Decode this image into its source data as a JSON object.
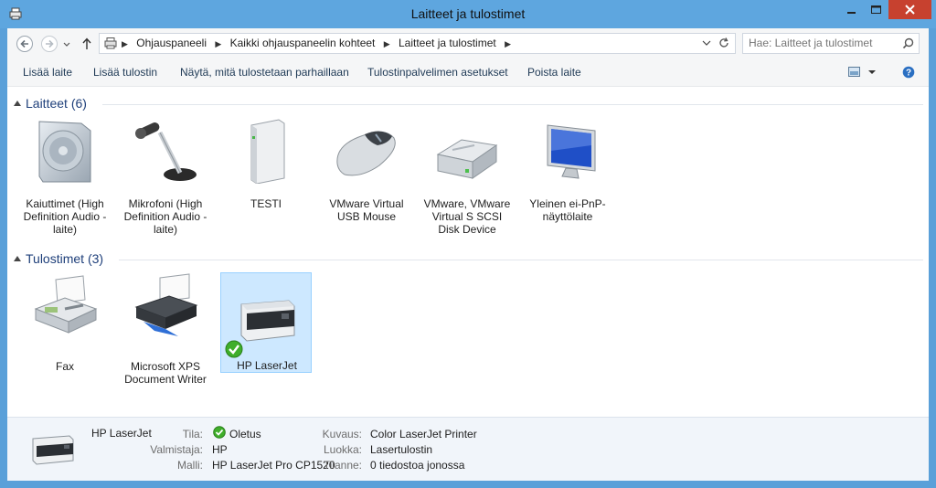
{
  "window": {
    "title": "Laitteet ja tulostimet"
  },
  "nav": {
    "breadcrumbs": [
      "Ohjauspaneeli",
      "Kaikki ohjauspaneelin kohteet",
      "Laitteet ja tulostimet"
    ],
    "search_placeholder": "Hae: Laitteet ja tulostimet"
  },
  "toolbar": {
    "add_device": "Lisää laite",
    "add_printer": "Lisää tulostin",
    "see_printing": "Näytä, mitä tulostetaan parhaillaan",
    "print_server": "Tulostinpalvelimen asetukset",
    "remove_device": "Poista laite"
  },
  "groups": {
    "devices": {
      "title": "Laitteet (6)",
      "items": [
        {
          "label": "Kaiuttimet (High Definition Audio -laite)",
          "icon": "speaker-icon"
        },
        {
          "label": "Mikrofoni (High Definition Audio -laite)",
          "icon": "microphone-icon"
        },
        {
          "label": "TESTI",
          "icon": "computer-tower-icon"
        },
        {
          "label": "VMware Virtual USB Mouse",
          "icon": "mouse-icon"
        },
        {
          "label": "VMware, VMware Virtual S SCSI Disk Device",
          "icon": "hard-disk-icon"
        },
        {
          "label": "Yleinen ei-PnP-näyttölaite",
          "icon": "monitor-icon"
        }
      ]
    },
    "printers": {
      "title": "Tulostimet (3)",
      "items": [
        {
          "label": "Fax",
          "icon": "fax-icon"
        },
        {
          "label": "Microsoft XPS Document Writer",
          "icon": "printer-icon"
        },
        {
          "label": "HP LaserJet",
          "icon": "laser-printer-icon",
          "selected": true,
          "default": true
        }
      ]
    }
  },
  "details": {
    "name": "HP LaserJet",
    "labels": {
      "status": "Tila:",
      "manufacturer": "Valmistaja:",
      "model": "Malli:",
      "description": "Kuvaus:",
      "category": "Luokka:",
      "queue": "Tilanne:"
    },
    "values": {
      "status": "Oletus",
      "manufacturer": "HP",
      "model": "HP LaserJet Pro CP1520",
      "description": "Color LaserJet Printer",
      "category": "Lasertulostin",
      "queue": "0 tiedostoa jonossa"
    }
  },
  "colors": {
    "titlebar": "#5ea6df",
    "close": "#c7412f",
    "selection": "#cde8ff",
    "group_header": "#1e3f7a"
  }
}
